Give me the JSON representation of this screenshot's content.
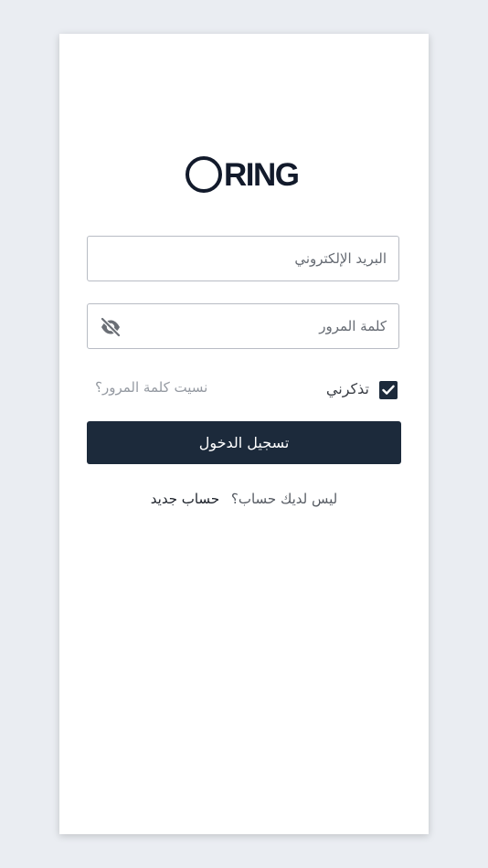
{
  "logo": {
    "text": "RING"
  },
  "email": {
    "placeholder": "البريد الإلكتروني",
    "value": ""
  },
  "password": {
    "placeholder": "كلمة المرور",
    "value": "",
    "toggle_icon": "eye-off-icon"
  },
  "remember": {
    "label": "تذكرني",
    "checked": true
  },
  "forgot_password": {
    "label": "نسيت كلمة المرور؟"
  },
  "login_button": {
    "label": "تسجيل الدخول"
  },
  "signup": {
    "question": "ليس لديك حساب؟",
    "link_label": "حساب جديد"
  },
  "colors": {
    "background": "#eaedf2",
    "card": "#ffffff",
    "primary": "#1c2a3b",
    "logo": "#121a2b"
  }
}
